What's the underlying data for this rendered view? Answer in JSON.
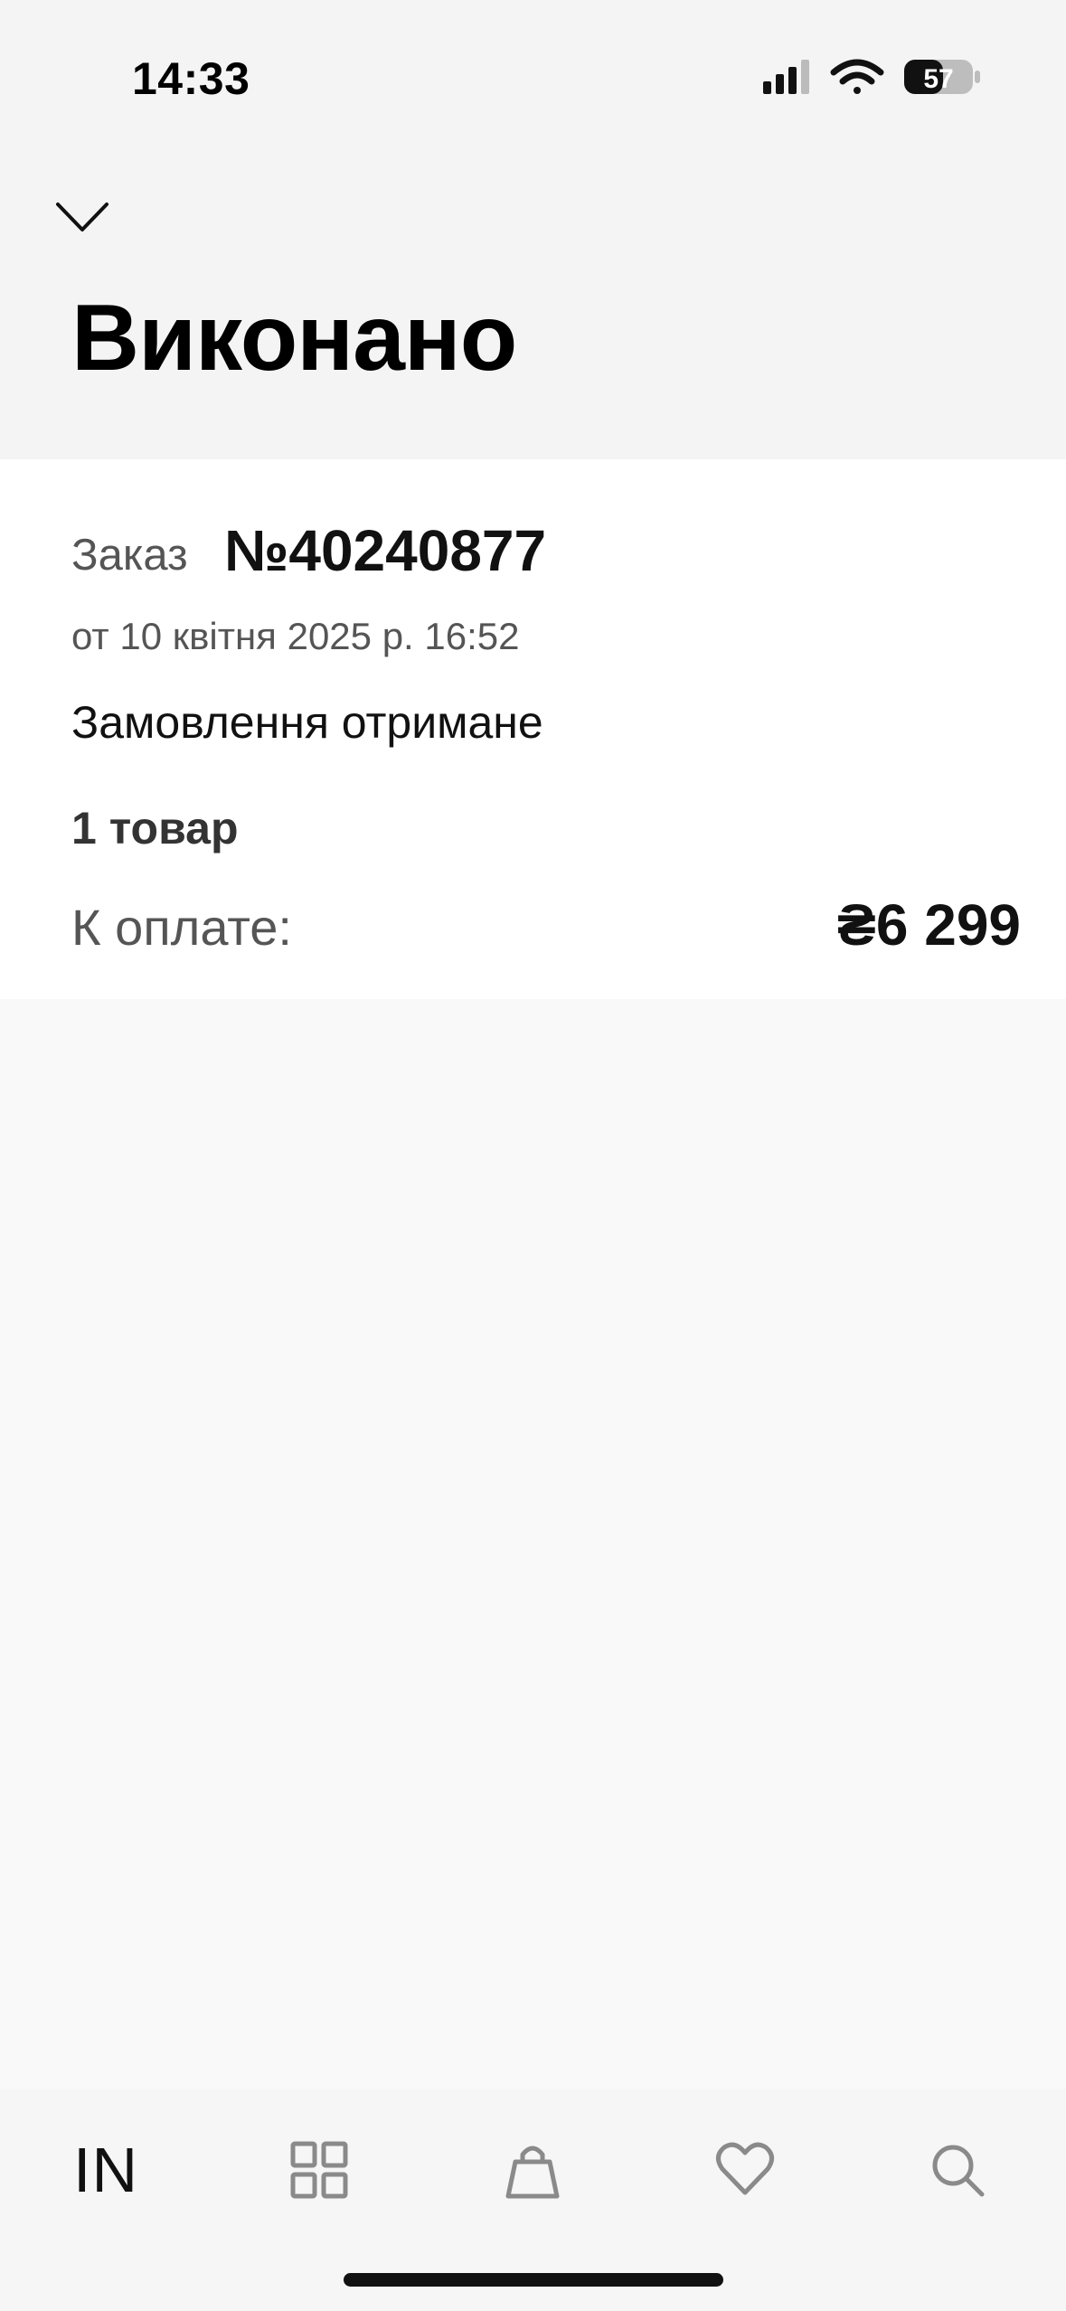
{
  "status_bar": {
    "time": "14:33",
    "battery": "57"
  },
  "header": {
    "title": "Виконано"
  },
  "order": {
    "label": "Заказ",
    "number": "№40240877",
    "date": "от 10 квітня 2025 р. 16:52",
    "status": "Замовлення отримане",
    "items": "1 товар",
    "pay_label": "К оплате:",
    "pay_amount": "₴6 299"
  },
  "tab_bar": {
    "brand": "IN",
    "icons": [
      "catalog-grid-icon",
      "shopping-bag-icon",
      "heart-icon",
      "search-icon"
    ]
  },
  "colors": {
    "background": "#f9f9f9",
    "header_bg": "#f4f4f4",
    "card_bg": "#ffffff",
    "text_primary": "#111111",
    "text_secondary": "#555555",
    "icon_gray": "#8a8a8a"
  }
}
